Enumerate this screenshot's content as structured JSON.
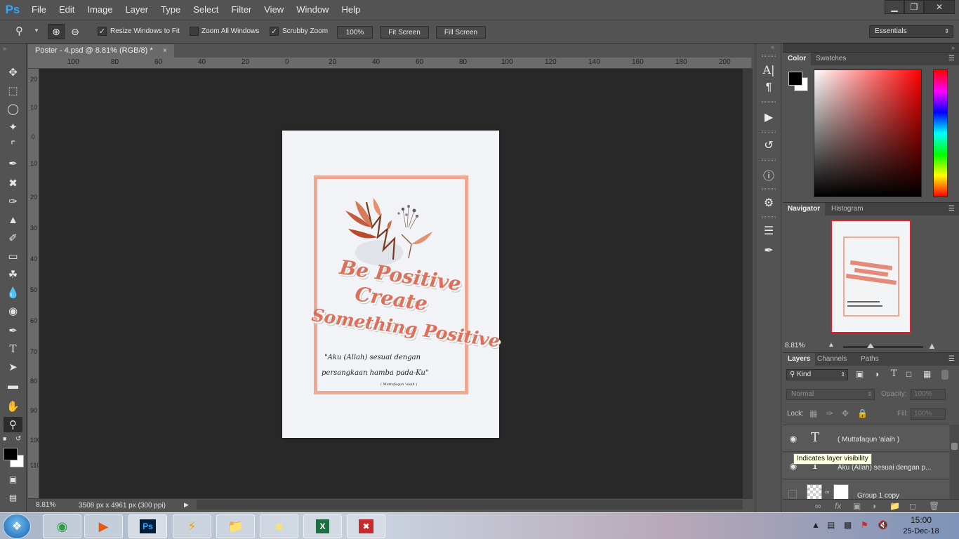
{
  "app": {
    "logo": "Ps"
  },
  "menu": [
    "File",
    "Edit",
    "Image",
    "Layer",
    "Type",
    "Select",
    "Filter",
    "View",
    "Window",
    "Help"
  ],
  "window_controls": {
    "minimize": "▁",
    "restore": "❐",
    "close": "✕"
  },
  "options": {
    "resize_windows_to_fit": {
      "label": "Resize Windows to Fit",
      "checked": true
    },
    "zoom_all_windows": {
      "label": "Zoom All Windows",
      "checked": false
    },
    "scrubby_zoom": {
      "label": "Scrubby Zoom",
      "checked": true
    },
    "btn_100": "100%",
    "btn_fit_screen": "Fit Screen",
    "btn_fill_screen": "Fill Screen",
    "workspace": "Essentials"
  },
  "document": {
    "tab_title": "Poster - 4.psd @ 8.81% (RGB/8) *",
    "close": "×",
    "zoom": "8.81%",
    "dimensions": "3508 px x 4961 px (300 ppi)"
  },
  "ruler_top": [
    "100",
    "80",
    "60",
    "40",
    "20",
    "0",
    "20",
    "40",
    "60",
    "80",
    "100",
    "120",
    "140",
    "160",
    "180",
    "200"
  ],
  "ruler_left": [
    "20",
    "10",
    "0",
    "10",
    "20",
    "30",
    "40",
    "50",
    "60",
    "70",
    "80",
    "90",
    "100",
    "110"
  ],
  "poster": {
    "line1": "Be Positive",
    "line2": "Create",
    "line3": "Something Positive",
    "quote1": "\"Aku (Allah) sesuai dengan",
    "quote2": "persangkaan hamba pada-Ku\"",
    "source": "( Muttafaqun 'alaih )"
  },
  "panels": {
    "color_tabs": [
      "Color",
      "Swatches"
    ],
    "navigator_tabs": [
      "Navigator",
      "Histogram"
    ],
    "navigator_zoom": "8.81%",
    "layers_tabs": [
      "Layers",
      "Channels",
      "Paths"
    ],
    "kind_filter": "Kind",
    "blend_mode": "Normal",
    "opacity_label": "Opacity:",
    "opacity_value": "100%",
    "lock_label": "Lock:",
    "fill_label": "Fill:",
    "fill_value": "100%",
    "layers": [
      {
        "name": "( Muttafaqun 'alaih )",
        "type": "text"
      },
      {
        "name": "Aku (Allah) sesuai dengan p...",
        "type": "text"
      },
      {
        "name": "Group 1 copy",
        "type": "group"
      }
    ],
    "tooltip": "Indicates layer visibility"
  },
  "taskbar": {
    "time": "15:00",
    "date": "25-Dec-18",
    "apps": [
      "chrome-icon",
      "media-player-icon",
      "photoshop-icon",
      "winamp-icon",
      "file-explorer-icon",
      "sticky-notes-icon",
      "excel-icon",
      "pdf-reader-icon"
    ]
  },
  "colors": {
    "ps_blue": "#31a8ff",
    "frame": "#f0a890",
    "title_text": "#df6f59",
    "canvas": "#282828",
    "panel": "#535353"
  }
}
